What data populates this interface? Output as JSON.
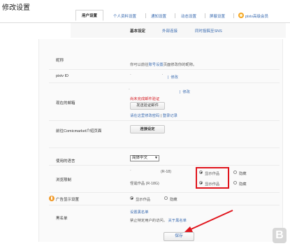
{
  "page": {
    "title": "修改设置"
  },
  "tabs": [
    {
      "label": "用户设置"
    },
    {
      "label": "个人资料设置"
    },
    {
      "label": "通知设置"
    },
    {
      "label": "动态设置"
    },
    {
      "label": "屏蔽设置"
    },
    {
      "label": "pixiv高级会员"
    }
  ],
  "subtabs": [
    {
      "label": "基本设定"
    },
    {
      "label": "外部连接"
    },
    {
      "label": "同时投稿至SNS"
    }
  ],
  "nickname": {
    "label": "昵称",
    "text_prefix": "你可以前往",
    "link": "账号设置",
    "text_suffix": "页面修改你的昵称。"
  },
  "pixiv_id": {
    "label": "pixiv ID",
    "edit": "修改"
  },
  "email": {
    "label": "现在的邮箱",
    "edit": "修改",
    "warning": "尚未完成邮件验证",
    "resend_button": "发送验证邮件",
    "help_link": "请在这里修改密码",
    "separator": "|",
    "login_history": "登录记录"
  },
  "comicmarket": {
    "label": "前往Comicmarket介绍页面",
    "button": "连接设定"
  },
  "language": {
    "label": "使用的语言",
    "selected": "简体中文"
  },
  "restrictions": {
    "label": "浏览限制",
    "r18_label": "(R-18)",
    "r18g_label": "怪诞作品 (R-18G)",
    "show": "显示作品",
    "hide": "隐藏"
  },
  "ads": {
    "label": "广告显示设置",
    "show": "显示作品",
    "hide": "隐藏"
  },
  "blacklist": {
    "label": "黑名单",
    "manage_link": "设置黑名单",
    "text": "禁止特定用户的访问。",
    "about_link": "关于黑名单"
  },
  "save_button": "保存",
  "colors": {
    "highlight": "#e0141c",
    "link": "#3a6bb0",
    "warning": "#d5161d"
  },
  "icons": {
    "premium": "premium-badge-icon",
    "ad": "ad-icon",
    "watermark": "b-logo-icon"
  }
}
